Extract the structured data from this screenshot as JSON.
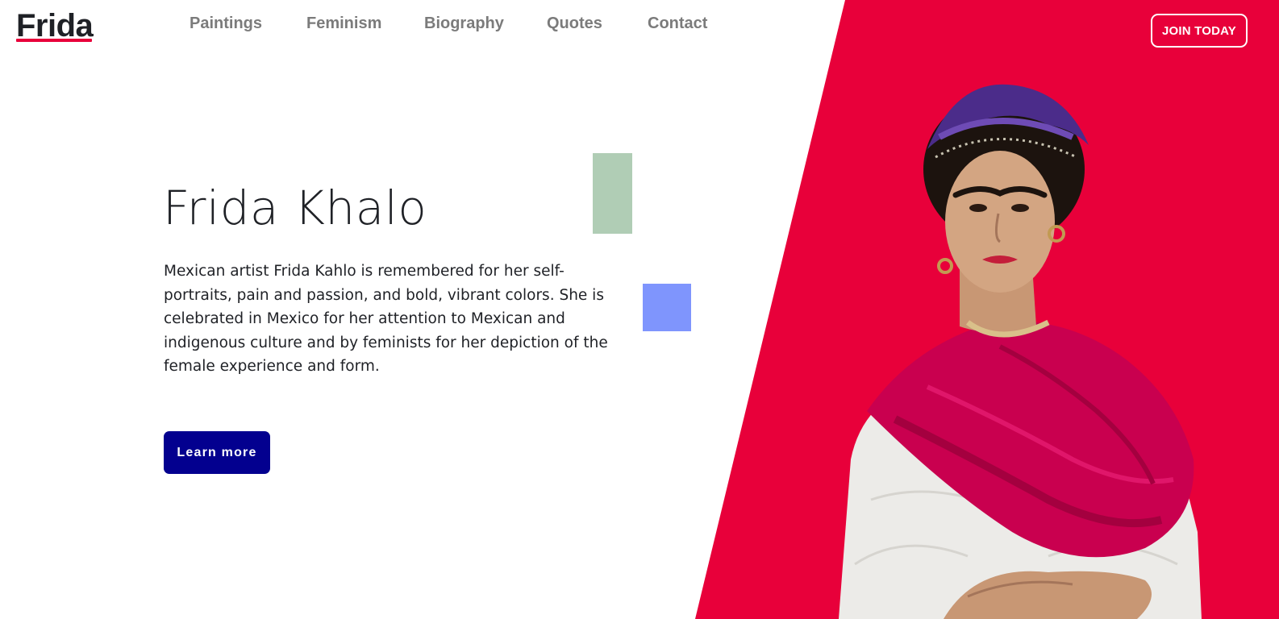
{
  "header": {
    "logo": "Frida",
    "nav": [
      "Paintings",
      "Feminism",
      "Biography",
      "Quotes",
      "Contact"
    ],
    "join_label": "JOIN TODAY"
  },
  "hero": {
    "title": "Frida Khalo",
    "description": "Mexican artist Frida Kahlo is remembered for her self-portraits, pain and passion, and bold, vibrant colors. She is celebrated in Mexico for her attention to Mexican and indigenous culture and by feminists for her depiction of the female experience and form.",
    "cta_label": "Learn more"
  },
  "colors": {
    "accent_red": "#e8003a",
    "cta_navy": "#03008f",
    "deco_green": "#b0cdb5",
    "deco_blue": "#7f95fd",
    "text_dark": "#1f2126",
    "nav_gray": "#7b7b7b"
  }
}
